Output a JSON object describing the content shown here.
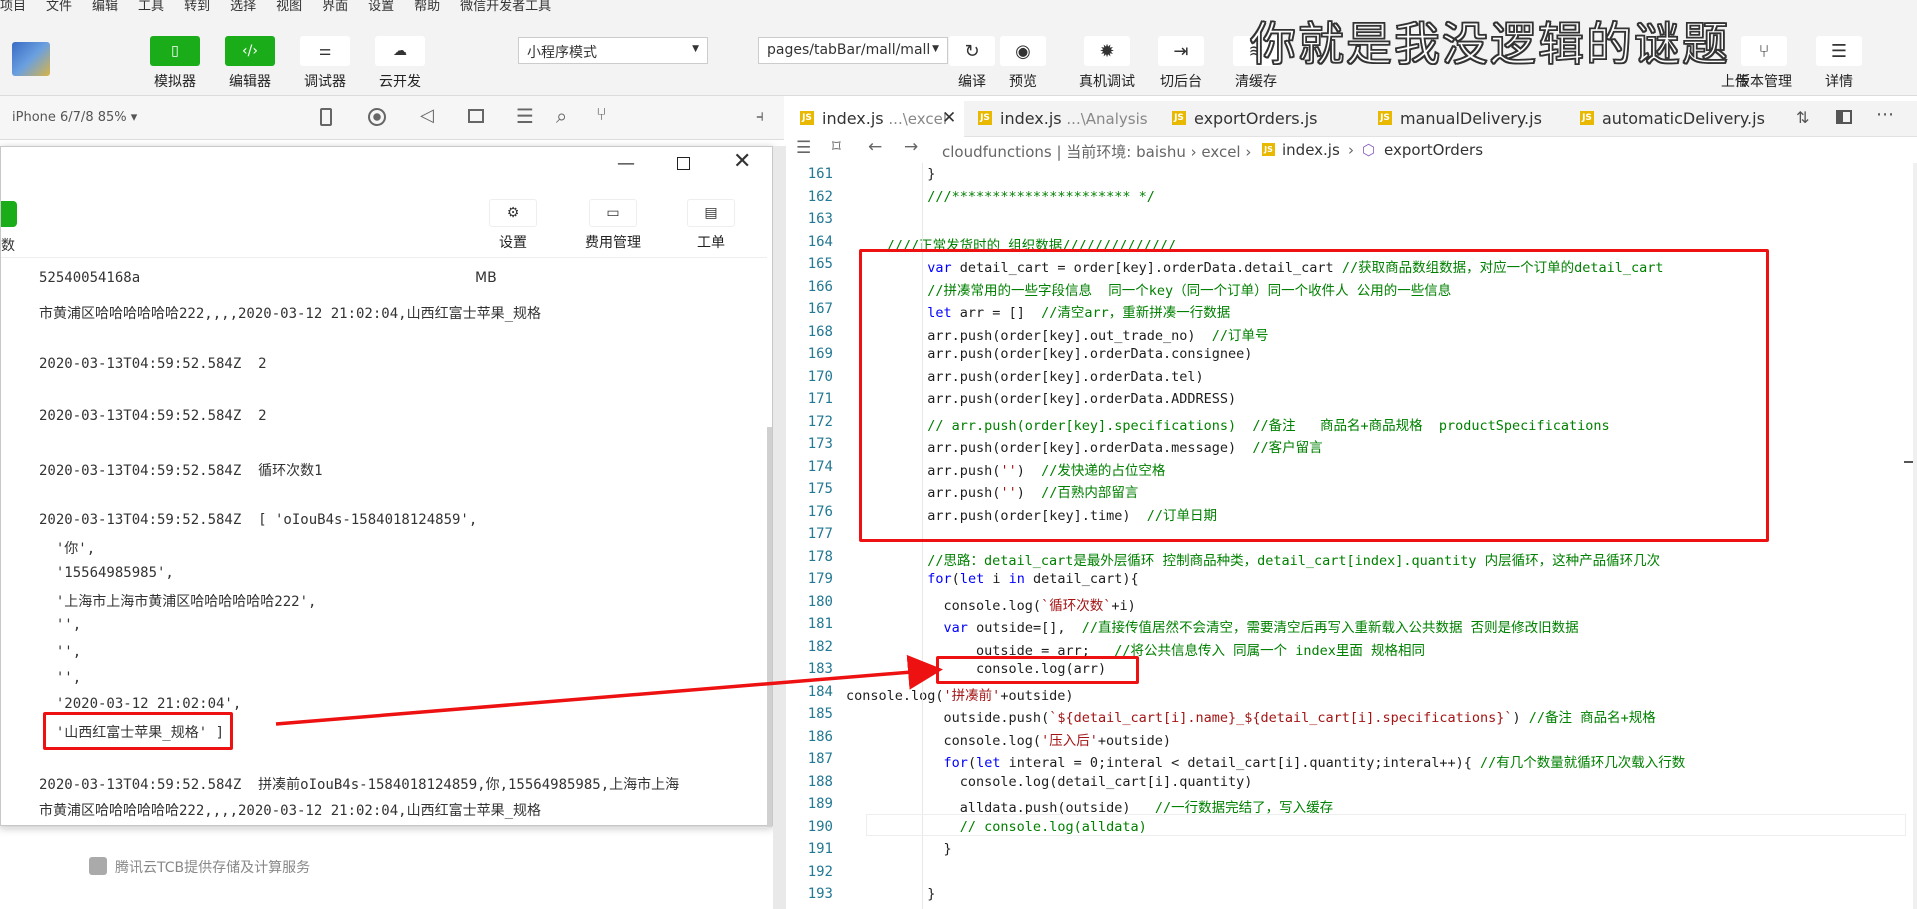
{
  "menubar": [
    "项目",
    "文件",
    "编辑",
    "工具",
    "转到",
    "选择",
    "视图",
    "界面",
    "设置",
    "帮助",
    "微信开发者工具"
  ],
  "toolbar": {
    "left_buttons": [
      {
        "label": "模拟器",
        "icon": "phone-icon",
        "style": "green"
      },
      {
        "label": "编辑器",
        "icon": "code-icon",
        "style": "green"
      },
      {
        "label": "调试器",
        "icon": "sliders-icon",
        "style": "white"
      },
      {
        "label": "云开发",
        "icon": "cloud-icon",
        "style": "white"
      }
    ],
    "mode_select": "小程序模式",
    "path_select": "pages/tabBar/mall/mall",
    "right_buttons": [
      {
        "label": "编译",
        "icon": "refresh-icon"
      },
      {
        "label": "预览",
        "icon": "eye-icon"
      },
      {
        "label": "真机调试",
        "icon": "bug-icon"
      },
      {
        "label": "切后台",
        "icon": "switch-icon"
      },
      {
        "label": "清缓存",
        "icon": "layers-icon"
      },
      {
        "label": "上传",
        "icon": "upload-icon"
      },
      {
        "label": "版本管理",
        "icon": "branch-icon"
      },
      {
        "label": "详情",
        "icon": "menu-icon"
      }
    ]
  },
  "watermark": "你就是我没逻辑的谜题",
  "simulator": {
    "device": "iPhone 6/7/8 85% ▾"
  },
  "cloud_window": {
    "side_partial": "数",
    "buttons": [
      {
        "label": "设置",
        "icon": "gear-icon"
      },
      {
        "label": "费用管理",
        "icon": "wallet-icon"
      },
      {
        "label": "工单",
        "icon": "ticket-icon"
      }
    ],
    "top_row_left": "52540054168a",
    "top_row_right": "MB",
    "console_lines": [
      "市黄浦区哈哈哈哈哈哈222,,,,2020-03-12 21:02:04,山西红富士苹果_规格",
      "2020-03-13T04:59:52.584Z  2",
      "2020-03-13T04:59:52.584Z  2",
      "2020-03-13T04:59:52.584Z  循环次数1",
      "2020-03-13T04:59:52.584Z  [ 'oIouB4s-1584018124859',",
      "  '你',",
      "  '15564985985',",
      "  '上海市上海市黄浦区哈哈哈哈哈哈222',",
      "  '',",
      "  '',",
      "  '',",
      "  '2020-03-12 21:02:04',",
      "  '山西红富士苹果_规格' ]",
      "2020-03-13T04:59:52.584Z  拼凑前oIouB4s-1584018124859,你,15564985985,上海市上海",
      "市黄浦区哈哈哈哈哈哈222,,,,2020-03-12 21:02:04,山西红富士苹果_规格"
    ],
    "footer": "腾讯云TCB提供存储及计算服务"
  },
  "editor": {
    "tabs": [
      {
        "name": "index.js",
        "sub": " ...\\excel",
        "active": true
      },
      {
        "name": "index.js",
        "sub": " ...\\Analysis",
        "active": false
      },
      {
        "name": "exportOrders.js",
        "sub": "",
        "active": false
      },
      {
        "name": "manualDelivery.js",
        "sub": "",
        "active": false
      },
      {
        "name": "automaticDelivery.js",
        "sub": "",
        "active": false
      }
    ],
    "breadcrumb": {
      "path": "cloudfunctions | 当前环境: baishu › excel ›",
      "file": "index.js",
      "sep": "›",
      "symbol": "exportOrders"
    },
    "lines": [
      {
        "n": "161",
        "t": "          }"
      },
      {
        "n": "162",
        "t": "          ///********************** */",
        "c": "c"
      },
      {
        "n": "163",
        "t": ""
      },
      {
        "n": "164",
        "t": "     ////正常发货时的 组织数据//////////////",
        "c": "c"
      },
      {
        "n": "165",
        "t": "          var detail_cart = order[key].orderData.detail_cart //获取商品数组数据，对应一个订单的detail_cart"
      },
      {
        "n": "166",
        "t": "          //拼凑常用的一些字段信息  同一个key（同一个订单）同一个收件人 公用的一些信息",
        "c": "c"
      },
      {
        "n": "167",
        "t": "          let arr = []  //清空arr，重新拼凑一行数据"
      },
      {
        "n": "168",
        "t": "          arr.push(order[key].out_trade_no)  //订单号"
      },
      {
        "n": "169",
        "t": "          arr.push(order[key].orderData.consignee)"
      },
      {
        "n": "170",
        "t": "          arr.push(order[key].orderData.tel)"
      },
      {
        "n": "171",
        "t": "          arr.push(order[key].orderData.ADDRESS)"
      },
      {
        "n": "172",
        "t": "          // arr.push(order[key].specifications)  //备注   商品名+商品规格  productSpecifications",
        "c": "c"
      },
      {
        "n": "173",
        "t": "          arr.push(order[key].orderData.message)  //客户留言"
      },
      {
        "n": "174",
        "t": "          arr.push('')  //发快递的占位空格"
      },
      {
        "n": "175",
        "t": "          arr.push('')  //百熟内部留言"
      },
      {
        "n": "176",
        "t": "          arr.push(order[key].time)  //订单日期"
      },
      {
        "n": "177",
        "t": ""
      },
      {
        "n": "178",
        "t": "          //思路：detail_cart是最外层循环 控制商品种类，detail_cart[index].quantity 内层循环，这种产品循环几次",
        "c": "c"
      },
      {
        "n": "179",
        "t": "          for(let i in detail_cart){"
      },
      {
        "n": "180",
        "t": "            console.log(`循环次数`+i)"
      },
      {
        "n": "181",
        "t": "            var outside=[],  //直接传值居然不会清空，需要清空后再写入重新载入公共数据 否则是修改旧数据"
      },
      {
        "n": "182",
        "t": "                outside = arr;   //将公共信息传入 同属一个 index里面 规格相同"
      },
      {
        "n": "183",
        "t": "                console.log(arr)"
      },
      {
        "n": "184",
        "t": "console.log('拼凑前'+outside)"
      },
      {
        "n": "185",
        "t": "            outside.push(`${detail_cart[i].name}_${detail_cart[i].specifications}`) //备注 商品名+规格"
      },
      {
        "n": "186",
        "t": "            console.log('压入后'+outside)"
      },
      {
        "n": "187",
        "t": "            for(let interal = 0;interal < detail_cart[i].quantity;interal++){ //有几个数量就循环几次载入行数"
      },
      {
        "n": "188",
        "t": "              console.log(detail_cart[i].quantity)"
      },
      {
        "n": "189",
        "t": "              alldata.push(outside)   //一行数据完结了，写入缓存"
      },
      {
        "n": "190",
        "t": "              // console.log(alldata)",
        "c": "c"
      },
      {
        "n": "191",
        "t": "            }"
      },
      {
        "n": "192",
        "t": ""
      },
      {
        "n": "193",
        "t": "          }"
      }
    ]
  }
}
